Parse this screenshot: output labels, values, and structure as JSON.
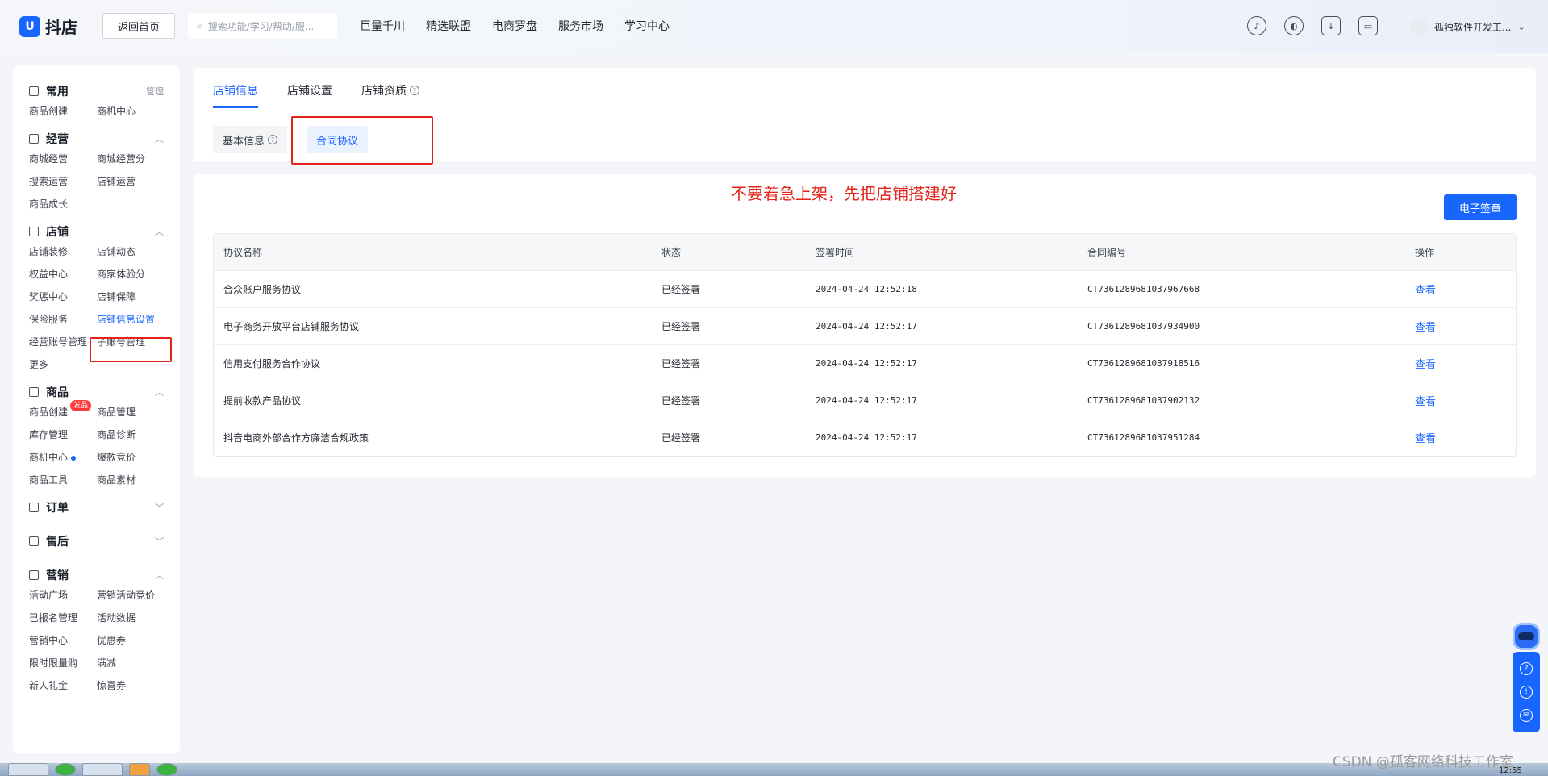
{
  "header": {
    "logo_mark": "U",
    "logo_text": "抖店",
    "back_button": "返回首页",
    "search_placeholder": "搜索功能/学习/帮助/服...",
    "nav": [
      "巨量千川",
      "精选联盟",
      "电商罗盘",
      "服务市场",
      "学习中心"
    ],
    "icons": [
      "bell-icon",
      "compass-icon",
      "download-icon",
      "store-icon"
    ],
    "user_name": "孤独软件开发工...",
    "user_caret": "⌄"
  },
  "sidebar": {
    "groups": [
      {
        "title": "常用",
        "right": "管理",
        "items": [
          "商品创建",
          "商机中心"
        ]
      },
      {
        "title": "经营",
        "right": "︿",
        "items": [
          "商城经营",
          "商城经营分",
          "搜索运营",
          "店铺运营",
          "商品成长"
        ]
      },
      {
        "title": "店铺",
        "right": "︿",
        "items": [
          "店铺装修",
          "店铺动态",
          "权益中心",
          "商家体验分",
          "奖惩中心",
          "店铺保障",
          "保险服务",
          "店铺信息设置",
          "经营账号管理",
          "子账号管理",
          "更多"
        ]
      },
      {
        "title": "商品",
        "right": "︿",
        "items": [
          "商品创建",
          "商品管理",
          "库存管理",
          "商品诊断",
          "商机中心",
          "爆款竞价",
          "商品工具",
          "商品素材"
        ],
        "badge": "发品"
      },
      {
        "title": "订单",
        "right": "﹀",
        "items": []
      },
      {
        "title": "售后",
        "right": "﹀",
        "items": []
      },
      {
        "title": "营销",
        "right": "︿",
        "items": [
          "活动广场",
          "营销活动竞价",
          "已报名管理",
          "活动数据",
          "营销中心",
          "优惠券",
          "限时限量购",
          "满减",
          "新人礼金",
          "惊喜券"
        ]
      }
    ],
    "active_item": "店铺信息设置"
  },
  "tabs": {
    "main": [
      "店铺信息",
      "店铺设置",
      "店铺资质"
    ],
    "sub": [
      "基本信息",
      "合同协议"
    ],
    "help_glyph": "?"
  },
  "content": {
    "hint": "不要着急上架，先把店铺搭建好",
    "esign_button": "电子签章",
    "columns": [
      "协议名称",
      "状态",
      "签署时间",
      "合同编号",
      "操作"
    ],
    "rows": [
      [
        "合众账户服务协议",
        "已经签署",
        "2024-04-24 12:52:18",
        "CT7361289681037967668",
        "查看"
      ],
      [
        "电子商务开放平台店铺服务协议",
        "已经签署",
        "2024-04-24 12:52:17",
        "CT7361289681037934900",
        "查看"
      ],
      [
        "信用支付服务合作协议",
        "已经签署",
        "2024-04-24 12:52:17",
        "CT7361289681037918516",
        "查看"
      ],
      [
        "提前收款产品协议",
        "已经签署",
        "2024-04-24 12:52:17",
        "CT7361289681037902132",
        "查看"
      ],
      [
        "抖音电商外部合作方廉洁合规政策",
        "已经签署",
        "2024-04-24 12:52:17",
        "CT7361289681037951284",
        "查看"
      ]
    ]
  },
  "footer": {
    "watermark": "CSDN @孤客网络科技工作室",
    "clock": "12:55"
  },
  "colors": {
    "accent": "#1966ff",
    "annotation_red": "#e2231a"
  }
}
